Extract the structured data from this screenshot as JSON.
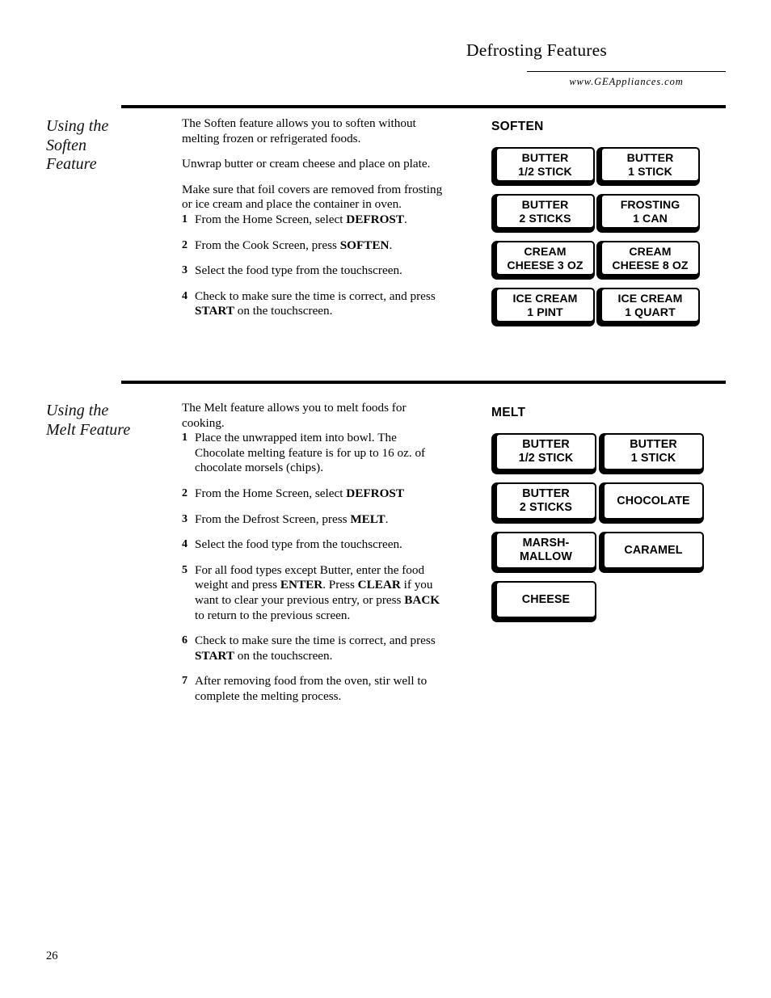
{
  "header": {
    "title": "Defrosting Features",
    "url": "www.GEAppliances.com"
  },
  "sections": [
    {
      "side_heading": "Using the\nSoften\nFeature",
      "paragraphs": [
        "The Soften feature allows you to soften without melting frozen or refrigerated foods.",
        "Unwrap butter or cream cheese and place on plate.",
        "Make sure that foil covers are removed from frosting or ice cream and place the container in oven."
      ],
      "steps": [
        {
          "num": "1",
          "html": "From the Home Screen, select <b>DEFROST</b>."
        },
        {
          "num": "2",
          "html": "From the Cook Screen, press <b>SOFTEN</b>."
        },
        {
          "num": "3",
          "html": "Select the food type from the touchscreen."
        },
        {
          "num": "4",
          "html": "Check to make sure the time is correct, and press <b>START</b> on the touchscreen."
        }
      ],
      "panel": {
        "label": "SOFTEN",
        "buttons": [
          "BUTTER\n1/2 STICK",
          "BUTTER\n1 STICK",
          "BUTTER\n2 STICKS",
          "FROSTING\n1 CAN",
          "CREAM\nCHEESE 3 OZ",
          "CREAM\nCHEESE 8 OZ",
          "ICE CREAM\n1 PINT",
          "ICE CREAM\n1 QUART"
        ]
      }
    },
    {
      "side_heading": "Using the\nMelt Feature",
      "paragraphs": [
        "The Melt feature allows you to melt foods for cooking."
      ],
      "steps": [
        {
          "num": "1",
          "html": "Place the unwrapped item into bowl. The Chocolate melting feature is for up to 16 oz. of chocolate morsels (chips)."
        },
        {
          "num": "2",
          "html": "From the Home Screen, select <b>DEFROST</b>"
        },
        {
          "num": "3",
          "html": "From the Defrost Screen, press <b>MELT</b>."
        },
        {
          "num": "4",
          "html": "Select the food type from the touchscreen."
        },
        {
          "num": "5",
          "html": "For all food types except Butter, enter the food weight and press <b>ENTER</b>. Press <b>CLEAR</b> if you want to clear your previous entry, or press <b>BACK</b> to return to the previous screen."
        },
        {
          "num": "6",
          "html": "Check to make sure the time is correct, and press <b>START</b> on the touchscreen."
        },
        {
          "num": "7",
          "html": "After removing food from the oven, stir well to complete the melting process."
        }
      ],
      "panel": {
        "label": "MELT",
        "buttons": [
          "BUTTER\n1/2 STICK",
          "BUTTER\n1 STICK",
          "BUTTER\n2 STICKS",
          "CHOCOLATE",
          "MARSH-\nMALLOW",
          "CARAMEL",
          "CHEESE"
        ]
      }
    }
  ],
  "footer": {
    "page_number": "26"
  },
  "colors": {
    "ink": "#000000",
    "paper": "#ffffff"
  }
}
